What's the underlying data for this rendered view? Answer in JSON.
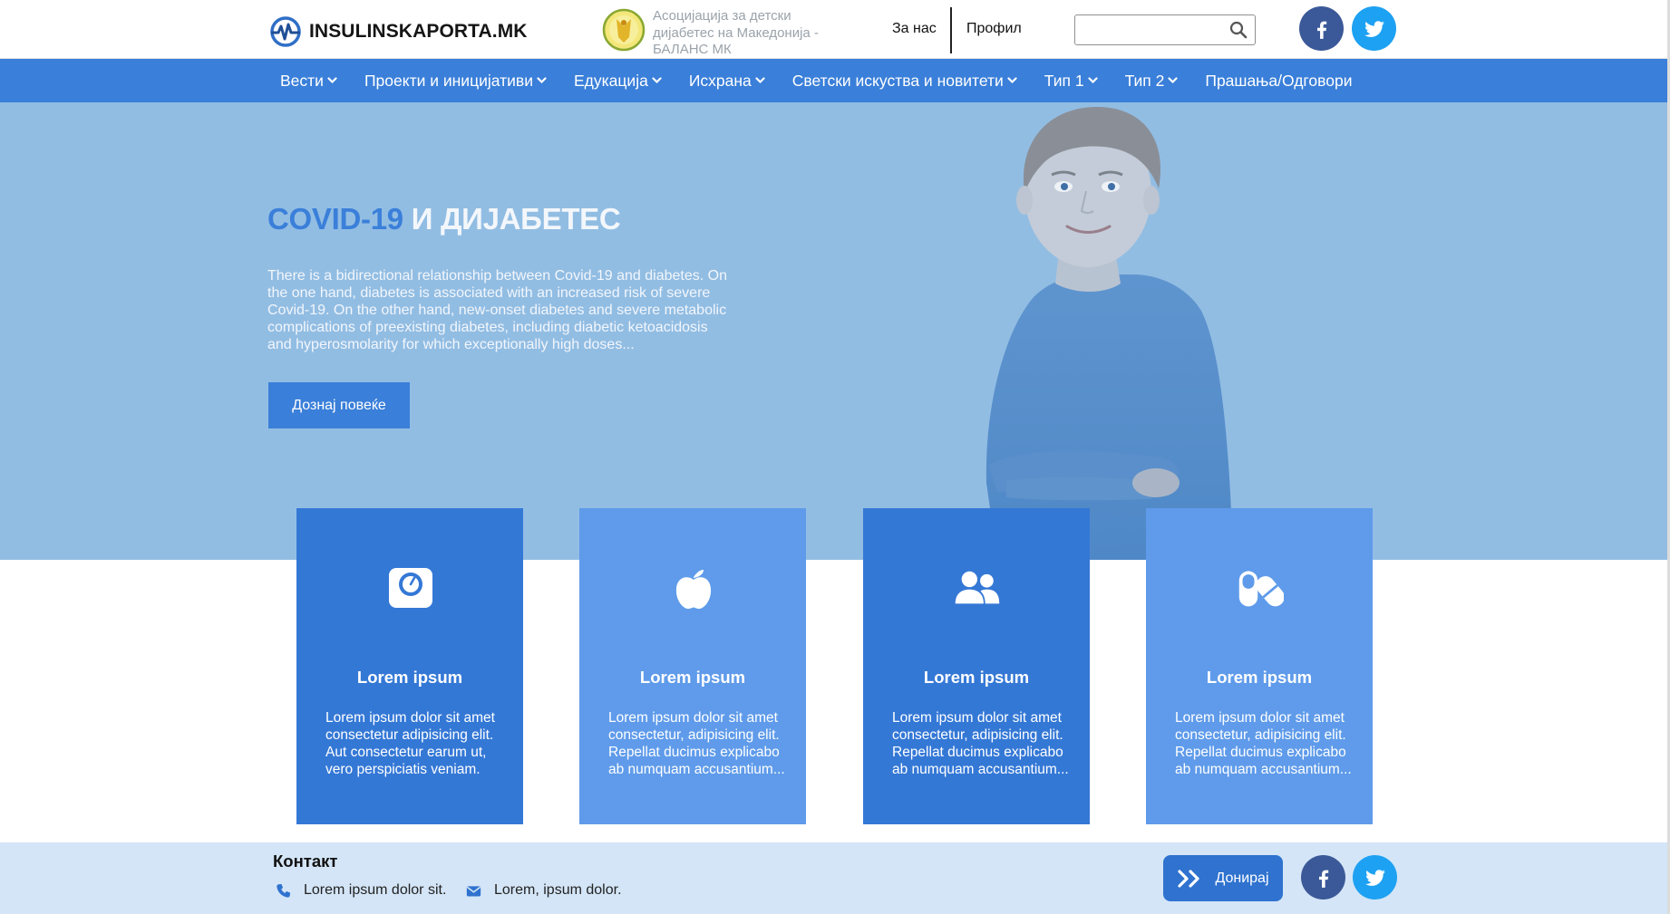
{
  "header": {
    "brand": "INSULINSKAPORTA.MK",
    "partner_text": "Асоцијација за детски дијабетес на Македонија - БАЛАНС МК",
    "about_label": "За нас",
    "profile_label": "Профил",
    "search": {
      "placeholder": "",
      "value": ""
    },
    "icons": {
      "brand": "heartbeat-logo",
      "partner": "association-logo",
      "search": "search-icon"
    }
  },
  "nav": {
    "items": [
      {
        "label": "Вести",
        "dropdown": true
      },
      {
        "label": "Проекти и иницијативи",
        "dropdown": true
      },
      {
        "label": "Едукација",
        "dropdown": true
      },
      {
        "label": "Исхрана",
        "dropdown": true
      },
      {
        "label": "Светски искуства и новитети",
        "dropdown": true
      },
      {
        "label": "Тип 1",
        "dropdown": true
      },
      {
        "label": "Тип 2",
        "dropdown": true
      },
      {
        "label": "Прашања/Одговори",
        "dropdown": false
      }
    ]
  },
  "hero": {
    "title_accent": "COVID-19",
    "title_rest": "И ДИЈАБЕТЕС",
    "text": "There is a bidirectional relationship between Covid-19 and diabetes. On the one hand, diabetes is associated with an increased risk of severe Covid-19. On the other hand, new-onset diabetes and severe metabolic complications of preexisting diabetes, including diabetic ketoacidosis and hyperosmolarity for which exceptionally high doses...",
    "button_label": "Дознај повеќе"
  },
  "cards": [
    {
      "icon": "weight-scale-icon",
      "title": "Lorem ipsum",
      "text": "Lorem ipsum dolor sit amet consectetur adipisicing elit. Aut consectetur earum ut, vero perspiciatis veniam."
    },
    {
      "icon": "apple-icon",
      "title": "Lorem ipsum",
      "text": "Lorem ipsum dolor sit amet consectetur, adipisicing elit. Repellat ducimus explicabo ab numquam accusantium..."
    },
    {
      "icon": "users-icon",
      "title": "Lorem ipsum",
      "text": "Lorem ipsum dolor sit amet consectetur, adipisicing elit. Repellat ducimus explicabo ab numquam accusantium..."
    },
    {
      "icon": "pills-icon",
      "title": "Lorem ipsum",
      "text": "Lorem ipsum dolor sit amet consectetur, adipisicing elit. Repellat ducimus explicabo ab numquam accusantium..."
    }
  ],
  "footer": {
    "title": "Контакт",
    "phone": "Lorem ipsum dolor sit.",
    "email": "Lorem, ipsum dolor.",
    "donate_label": "Донирај"
  },
  "colors": {
    "primary": "#3a7fd9",
    "hero_bg": "#92bde3",
    "card_dark": "#3478d6",
    "card_light": "#5f9bea",
    "footer_bg": "#d3e5f7",
    "facebook": "#3b5998",
    "twitter": "#1da1f2"
  }
}
